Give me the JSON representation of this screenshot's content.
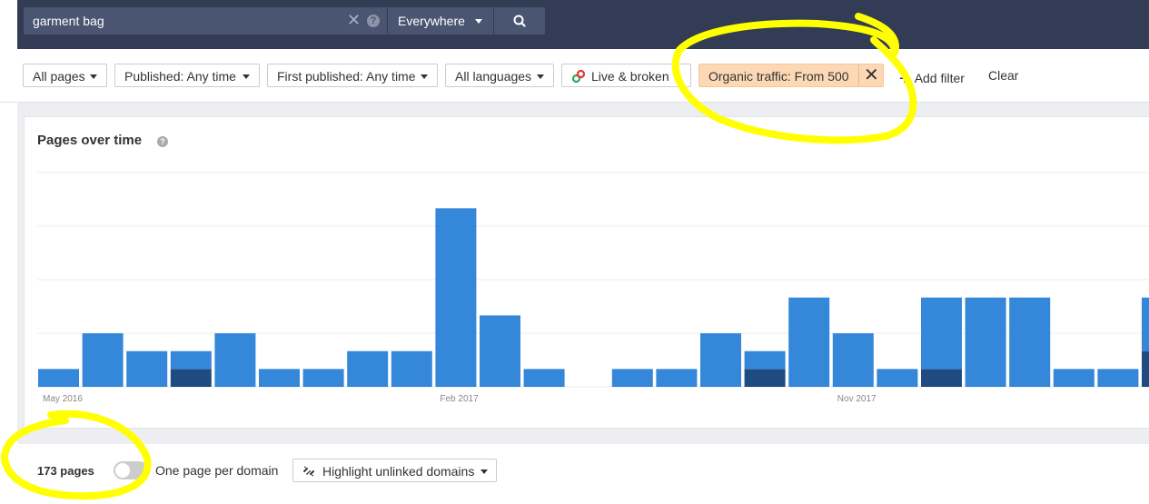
{
  "search": {
    "value": "garment bag",
    "clear_glyph": "✕",
    "help_glyph": "?",
    "scope": "Everywhere"
  },
  "filters": {
    "all_pages": "All pages",
    "published": "Published: Any time",
    "first_published": "First published: Any time",
    "languages": "All languages",
    "live_broken": "Live & broken",
    "organic": "Organic traffic: From 500",
    "remove_glyph": "✕",
    "add_glyph": "+",
    "add_filter": "Add filter",
    "clear": "Clear"
  },
  "card": {
    "title": "Pages over time",
    "help_glyph": "?"
  },
  "chart_data": {
    "type": "bar",
    "stacked": true,
    "ylim": [
      0,
      12
    ],
    "grid": true,
    "x_tick_labels": [
      "May 2016",
      "Feb 2017",
      "Nov 2017"
    ],
    "x_tick_index": [
      0,
      9,
      18
    ],
    "series": [
      {
        "color": "#1e4c80",
        "values": [
          0,
          0,
          0,
          1,
          0,
          0,
          0,
          0,
          0,
          0,
          0,
          0,
          0,
          0,
          0,
          0,
          1,
          0,
          0,
          0,
          1,
          0,
          0,
          0,
          0,
          2
        ]
      },
      {
        "color": "#3587d9",
        "values": [
          1,
          3,
          2,
          1,
          3,
          1,
          1,
          2,
          2,
          10,
          4,
          1,
          0,
          1,
          1,
          3,
          1,
          5,
          3,
          1,
          4,
          5,
          5,
          1,
          1,
          3
        ]
      }
    ],
    "colors": {
      "light": "#3587d9",
      "dark": "#1e4c80",
      "grid": "#ececec"
    }
  },
  "bottom": {
    "count": "173 pages",
    "toggle_label": "One page per domain",
    "highlight": "Highlight unlinked domains"
  },
  "annotation_color": "#ffff00"
}
